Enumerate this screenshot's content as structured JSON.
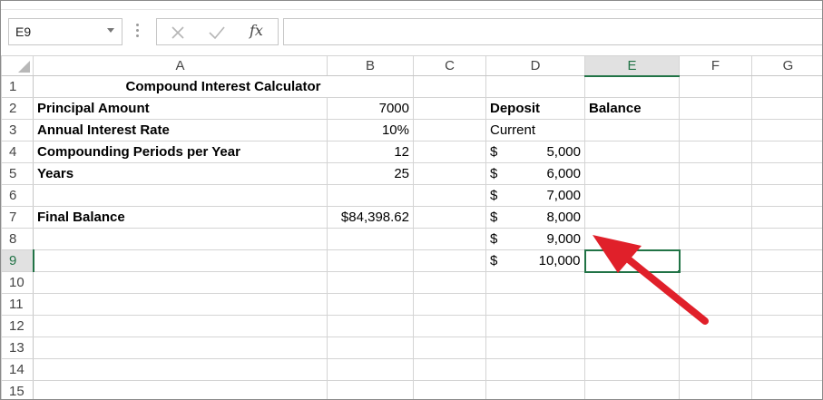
{
  "formula_bar": {
    "name_box": "E9",
    "fx_label": "fx",
    "formula": ""
  },
  "columns": [
    "A",
    "B",
    "C",
    "D",
    "E",
    "F",
    "G"
  ],
  "rows": [
    "1",
    "2",
    "3",
    "4",
    "5",
    "6",
    "7",
    "8",
    "9",
    "10",
    "11",
    "12",
    "13",
    "14",
    "15"
  ],
  "cells": {
    "A1": "Compound Interest Calculator",
    "A2": "Principal Amount",
    "A3": "Annual Interest Rate",
    "A4": "Compounding Periods per Year",
    "A5": "Years",
    "A7": "Final Balance",
    "B2": "7000",
    "B3": "10%",
    "B4": "12",
    "B5": "25",
    "B7": "$84,398.62",
    "D2": "Deposit",
    "D3": "Current",
    "D4": {
      "currency": "$",
      "amount": "5,000"
    },
    "D5": {
      "currency": "$",
      "amount": "6,000"
    },
    "D6": {
      "currency": "$",
      "amount": "7,000"
    },
    "D7": {
      "currency": "$",
      "amount": "8,000"
    },
    "D8": {
      "currency": "$",
      "amount": "9,000"
    },
    "D9": {
      "currency": "$",
      "amount": "10,000"
    },
    "E2": "Balance"
  },
  "selection": {
    "cell": "E9",
    "column": "E",
    "row": "9"
  },
  "colors": {
    "accent_green": "#217346",
    "annotation_arrow": "#e0202a",
    "gridline": "#d4d4d4"
  },
  "icons": [
    "cancel-icon",
    "enter-icon",
    "fx-icon",
    "dropdown-arrow-icon",
    "select-all-icon"
  ]
}
